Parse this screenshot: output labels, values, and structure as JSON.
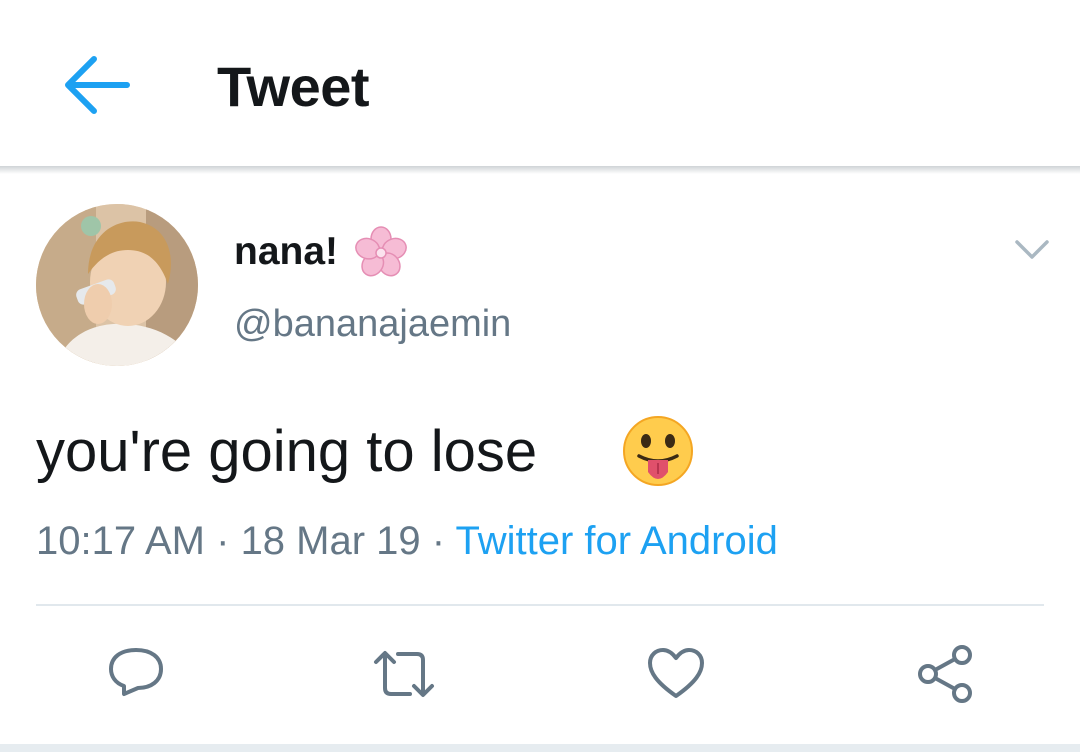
{
  "header": {
    "title": "Tweet",
    "back_icon": "arrow-left-icon"
  },
  "tweet": {
    "display_name": "nana!",
    "name_emoji": "cherry-blossom-icon",
    "handle": "@bananajaemin",
    "text": "you're going to lose",
    "text_emoji": "face-with-tongue-icon",
    "time": "10:17 AM",
    "separator": " · ",
    "date": "18 Mar 19",
    "source": "Twitter for Android"
  },
  "actions": [
    {
      "name": "reply",
      "icon": "reply-icon"
    },
    {
      "name": "retweet",
      "icon": "retweet-icon"
    },
    {
      "name": "like",
      "icon": "heart-icon"
    },
    {
      "name": "share",
      "icon": "share-icon"
    }
  ],
  "colors": {
    "accent": "#1da1f2",
    "text": "#14171a",
    "secondary_text": "#657786",
    "icon": "#657786",
    "divider": "#e1e8ed"
  }
}
